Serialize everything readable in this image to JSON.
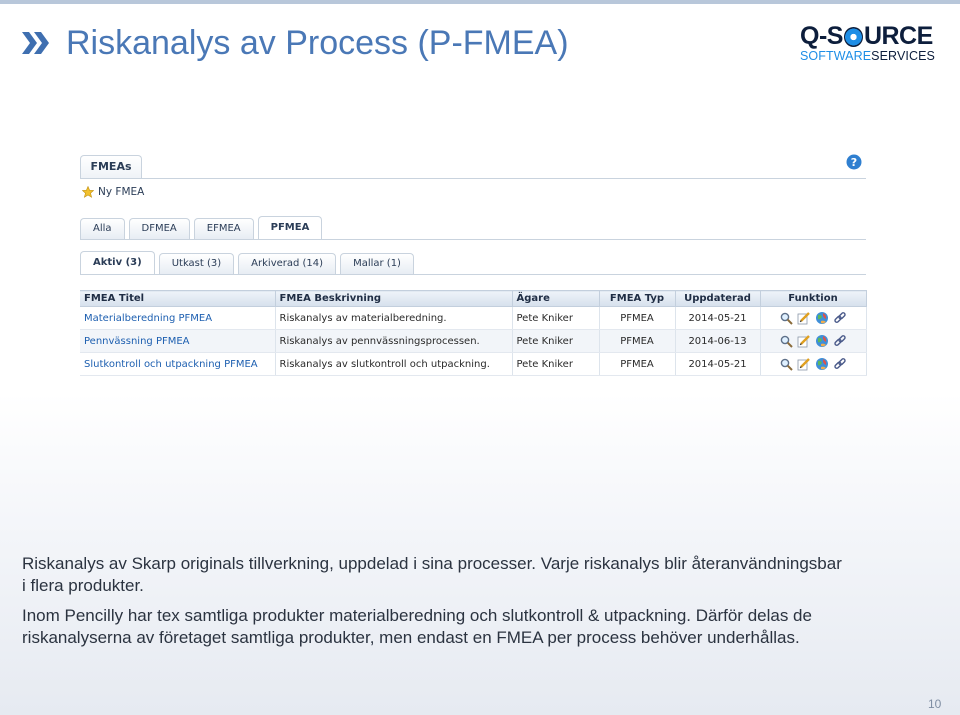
{
  "slide": {
    "title": "Riskanalys av Process (P-FMEA)",
    "page_number": "10"
  },
  "logo": {
    "text_left": "Q-S",
    "text_right": "URCE",
    "sub_left": "SOFTWARE",
    "sub_right": "SERVICES",
    "colors": {
      "navy": "#0d1e3c",
      "blue": "#1e8ee6"
    }
  },
  "app": {
    "main_tab": "FMEAs",
    "new_fmea_label": "Ny FMEA",
    "type_tabs": [
      {
        "label": "Alla",
        "active": false
      },
      {
        "label": "DFMEA",
        "active": false
      },
      {
        "label": "EFMEA",
        "active": false
      },
      {
        "label": "PFMEA",
        "active": true
      }
    ],
    "status_tabs": [
      {
        "label": "Aktiv (3)",
        "active": true
      },
      {
        "label": "Utkast (3)",
        "active": false
      },
      {
        "label": "Arkiverad (14)",
        "active": false
      },
      {
        "label": "Mallar (1)",
        "active": false
      }
    ],
    "table": {
      "columns": [
        "FMEA Titel",
        "FMEA Beskrivning",
        "Ägare",
        "FMEA Typ",
        "Uppdaterad",
        "Funktion"
      ],
      "rows": [
        {
          "title": "Materialberedning PFMEA",
          "description": "Riskanalys av materialberedning.",
          "owner": "Pete Kniker",
          "type": "PFMEA",
          "updated": "2014-05-21"
        },
        {
          "title": "Pennvässning PFMEA",
          "description": "Riskanalys av pennvässningsprocessen.",
          "owner": "Pete Kniker",
          "type": "PFMEA",
          "updated": "2014-06-13"
        },
        {
          "title": "Slutkontroll och utpackning PFMEA",
          "description": "Riskanalys av slutkontroll och utpackning.",
          "owner": "Pete Kniker",
          "type": "PFMEA",
          "updated": "2014-05-21"
        }
      ],
      "function_icons": [
        "magnifier-icon",
        "pencil-edit-icon",
        "globe-icon",
        "link-icon"
      ]
    }
  },
  "body": {
    "line1": "Riskanalys av Skarp originals tillverkning, uppdelad i sina processer. Varje riskanalys blir återanvändningsbar",
    "line2": "i flera produkter.",
    "line3": "Inom Pencilly har tex samtliga produkter materialberedning och slutkontroll & utpackning. Därför delas de",
    "line4": "riskanalyserna av företaget samtliga produkter, men endast en FMEA per process behöver underhållas."
  }
}
